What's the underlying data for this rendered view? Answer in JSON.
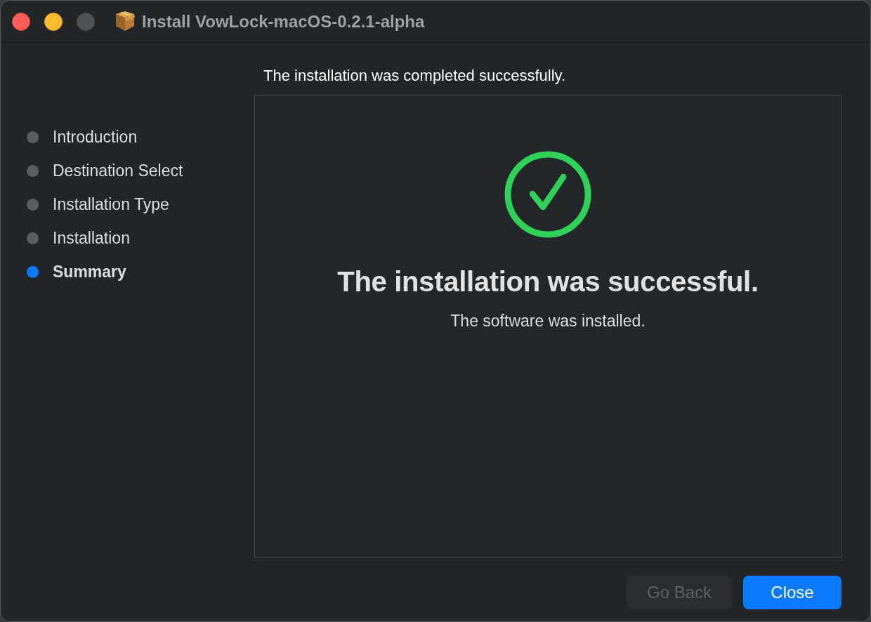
{
  "window": {
    "title": "Install VowLock-macOS-0.2.1-alpha"
  },
  "sidebar": {
    "steps": [
      {
        "label": "Introduction",
        "selected": false
      },
      {
        "label": "Destination Select",
        "selected": false
      },
      {
        "label": "Installation Type",
        "selected": false
      },
      {
        "label": "Installation",
        "selected": false
      },
      {
        "label": "Summary",
        "selected": true
      }
    ]
  },
  "header": "The installation was completed successfully.",
  "panel": {
    "heading": "The installation was successful.",
    "message": "The software was installed."
  },
  "buttons": [
    {
      "label": "Go Back",
      "kind": "secondary",
      "disabled": true
    },
    {
      "label": "Close",
      "kind": "primary",
      "disabled": false
    }
  ]
}
